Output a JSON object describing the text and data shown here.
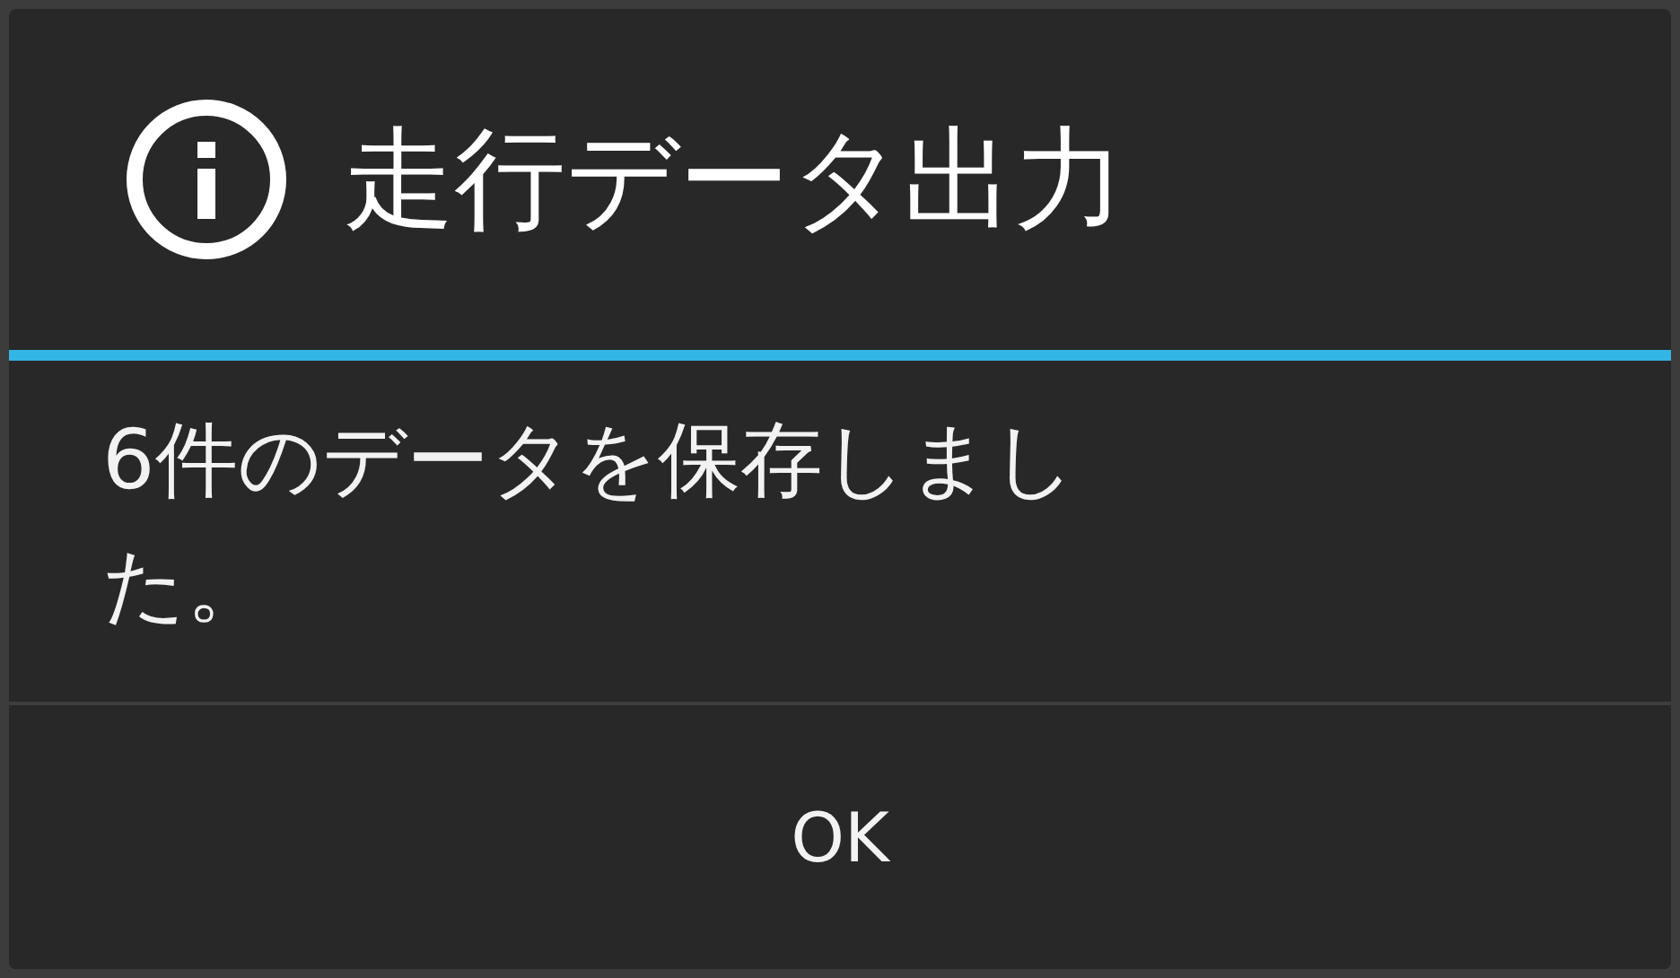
{
  "dialog": {
    "title": "走行データ出力",
    "message": "6件のデータを保存しました。",
    "buttons": [
      "OK"
    ]
  }
}
